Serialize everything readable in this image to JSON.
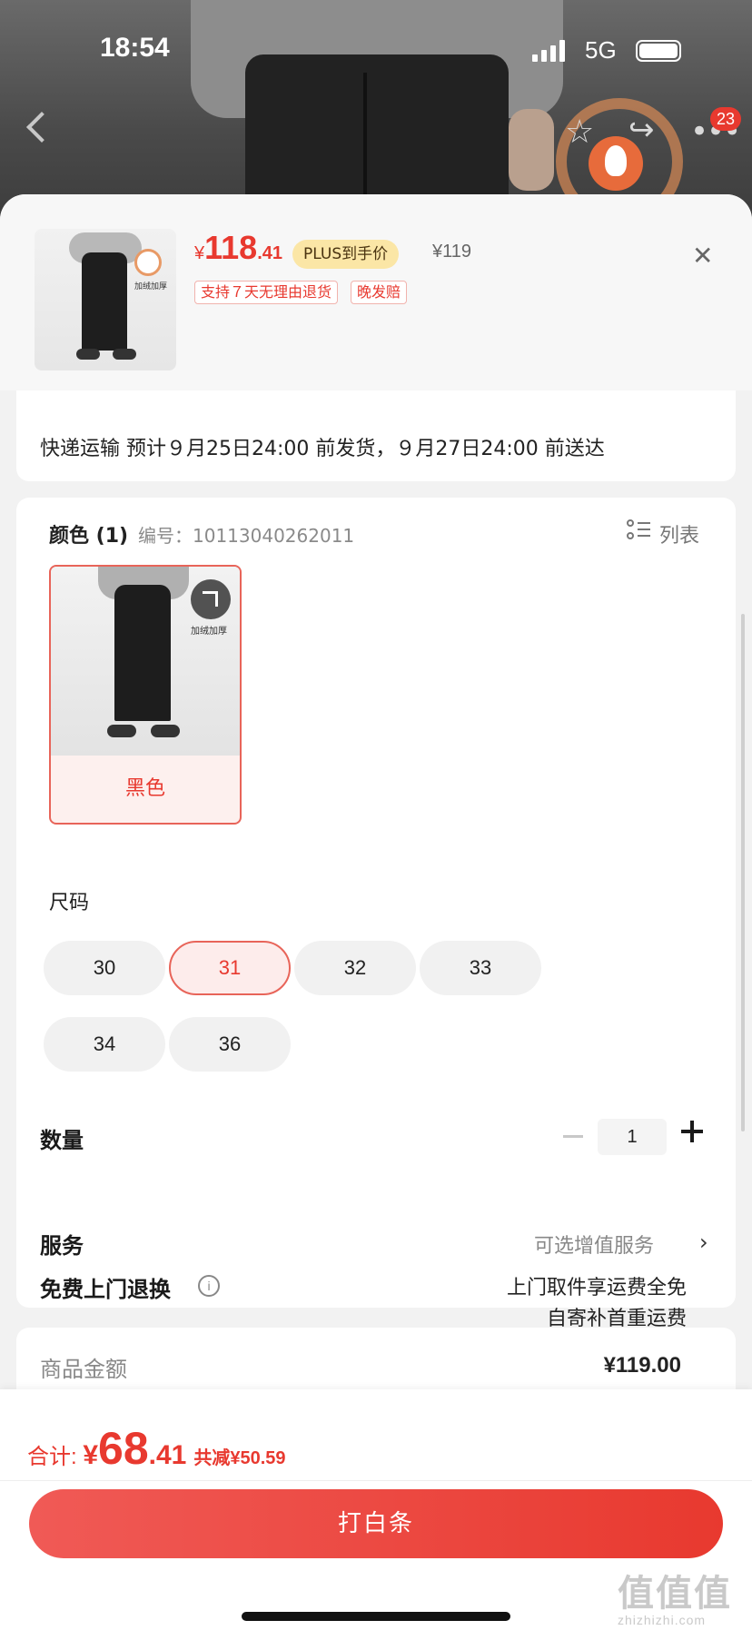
{
  "status_bar": {
    "time": "18:54",
    "network": "5G"
  },
  "nav": {
    "cart_badge": "23"
  },
  "product": {
    "price_symbol": "¥",
    "price_int": "118",
    "price_dec": ".41",
    "plus_label": "PLUS到手价",
    "original_price": "¥119",
    "thumb_label": "加绒加厚",
    "tags": [
      "支持７天无理由退货",
      "晚发赔"
    ]
  },
  "shipping": {
    "text": "快递运输 预计９月25日24:00 前发货，９月27日24:00 前送达"
  },
  "color": {
    "label": "颜色 (1)",
    "sku": "编号：10113040262011",
    "list_label": "列表",
    "options": [
      {
        "name": "黑色",
        "badge": "加绒加厚",
        "selected": true
      }
    ]
  },
  "size": {
    "label": "尺码",
    "options": [
      "30",
      "31",
      "32",
      "33",
      "34",
      "36"
    ],
    "selected": "31"
  },
  "quantity": {
    "label": "数量",
    "value": "1"
  },
  "service": {
    "label": "服务",
    "value": "可选增值服务"
  },
  "free_return": {
    "label": "免费上门退换",
    "line1": "上门取件享运费全免",
    "line2": "自寄补首重运费"
  },
  "amount": {
    "label": "商品金额",
    "value": "¥119.00"
  },
  "total": {
    "label": "合计: ",
    "symbol": "¥",
    "int": "68",
    "dec": ".41",
    "saving": "共减¥50.59"
  },
  "cta": {
    "label": "打白条"
  },
  "watermark": {
    "big": "值值值",
    "small": "zhizhizhi.com"
  },
  "colors": {
    "accent": "#e8392f",
    "plus_bg": "#fbe6a6",
    "sheet_bg": "#f2f2f2"
  }
}
